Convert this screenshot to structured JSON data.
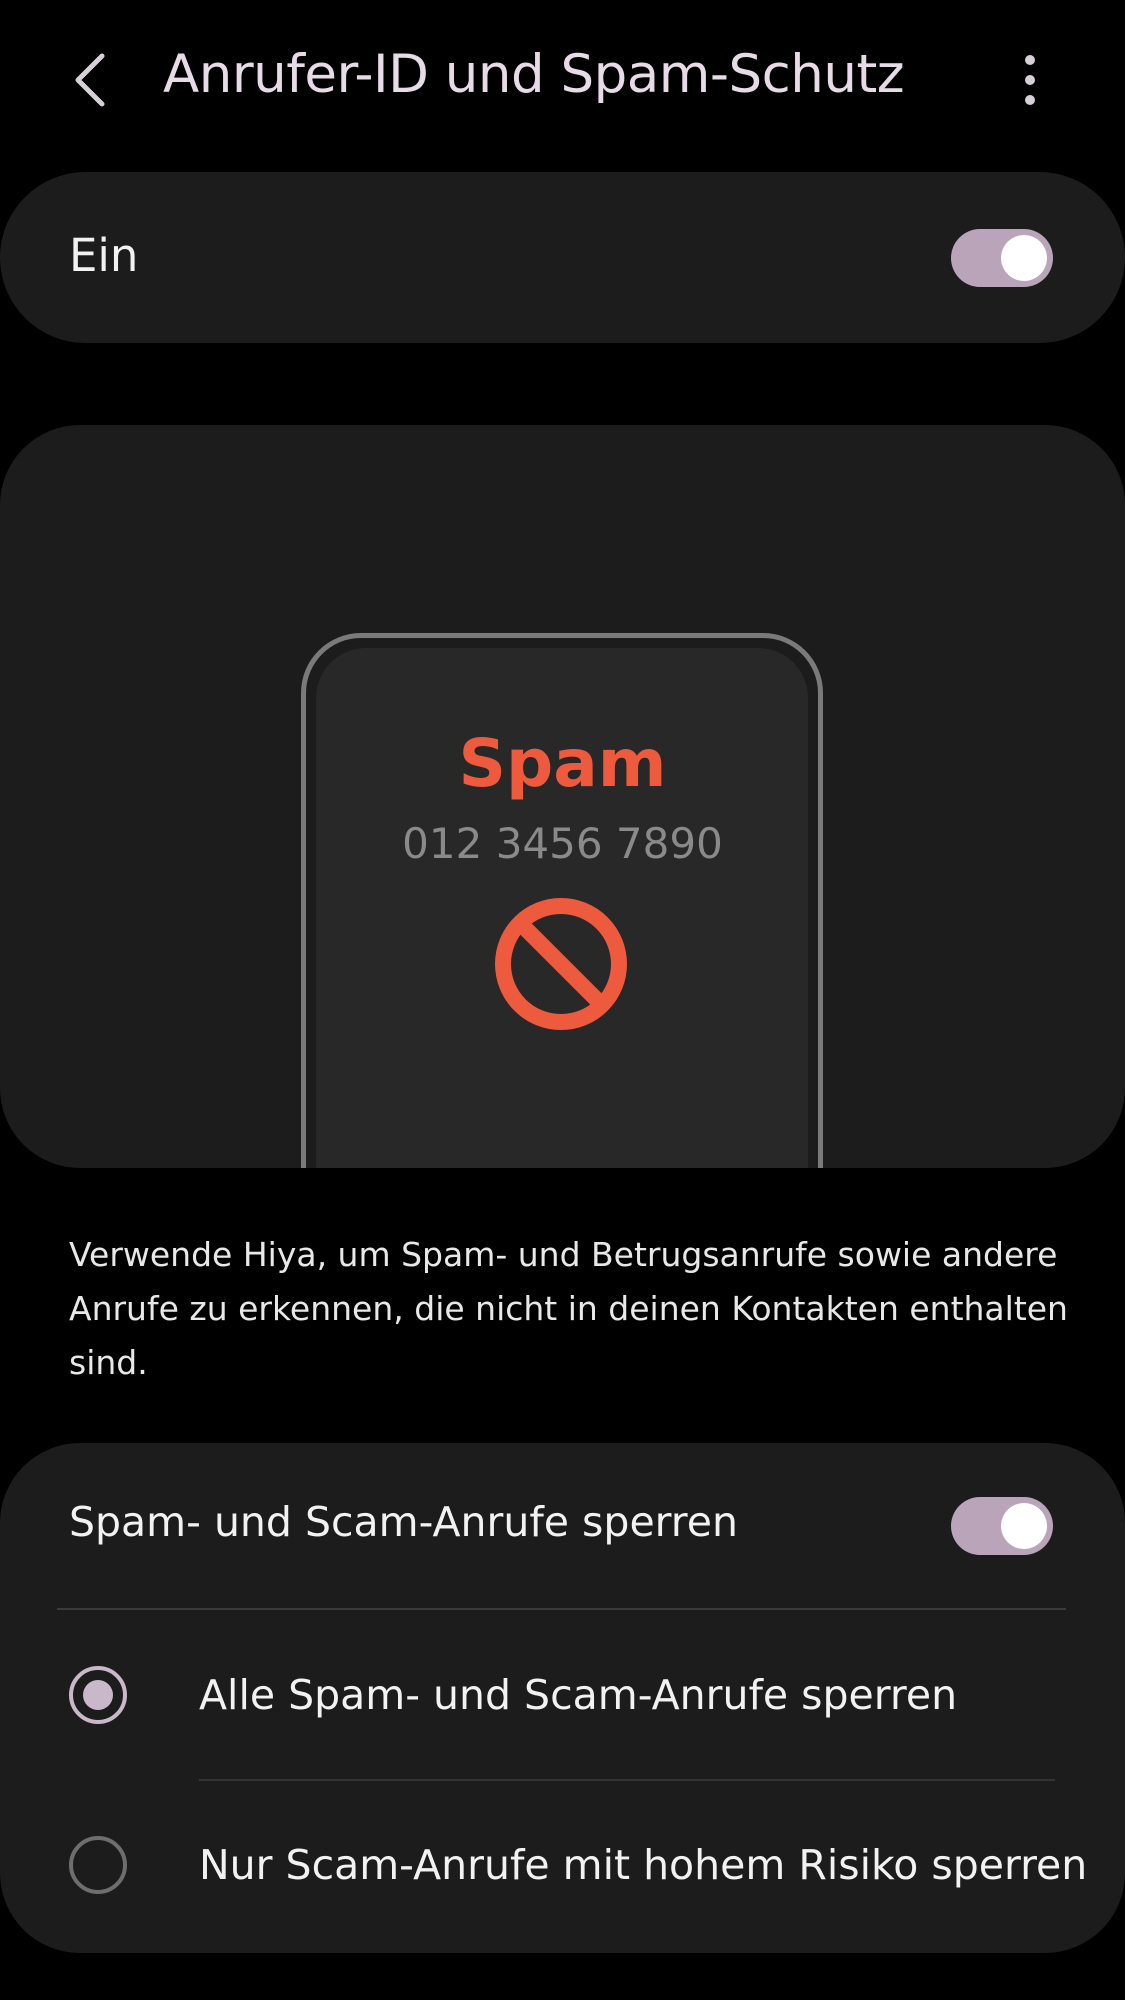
{
  "header": {
    "title": "Anrufer-ID und Spam-Schutz"
  },
  "master": {
    "label": "Ein",
    "enabled": true
  },
  "illustration": {
    "caller_label": "Spam",
    "caller_number": "012 3456 7890"
  },
  "description": "Verwende Hiya, um Spam- und Betrugsanrufe sowie andere Anrufe zu erkennen, die nicht in deinen Kontakten enthalten sind.",
  "blocking": {
    "label": "Spam- und Scam-Anrufe sperren",
    "enabled": true,
    "options": [
      {
        "label": "Alle Spam- und Scam-Anrufe sperren",
        "selected": true
      },
      {
        "label": "Nur Scam-Anrufe mit hohem Risiko sperren",
        "selected": false
      }
    ]
  },
  "colors": {
    "accent": "#b9a4ba",
    "spam_red": "#ee5a3e",
    "background": "#000000",
    "card": "#1c1c1c"
  }
}
